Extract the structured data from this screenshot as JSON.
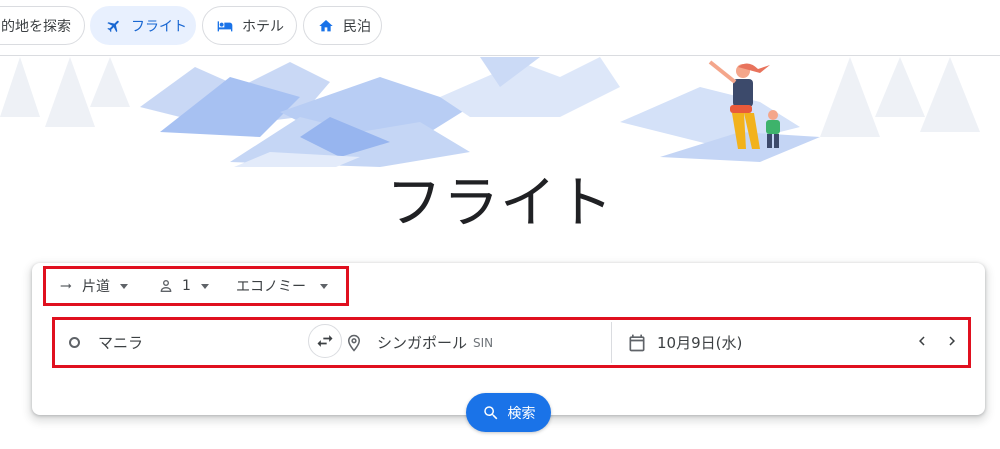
{
  "tabs": [
    {
      "label": "的地を探索",
      "icon": "explore-icon"
    },
    {
      "label": "フライト",
      "icon": "airplane-icon",
      "active": true
    },
    {
      "label": "ホテル",
      "icon": "bed-icon"
    },
    {
      "label": "民泊",
      "icon": "house-icon"
    }
  ],
  "page": {
    "title": "フライト"
  },
  "trip_options": {
    "trip_type": "片道",
    "passengers": "1",
    "cabin_class": "エコノミー"
  },
  "route": {
    "origin": "マニラ",
    "destination": "シンガポール",
    "destination_code": "SIN",
    "date": "10月9日(水)"
  },
  "search": {
    "label": "検索"
  },
  "colors": {
    "accent": "#1a73e8",
    "active_tab_bg": "#e8f0fe",
    "highlight_box": "#e0101f"
  }
}
